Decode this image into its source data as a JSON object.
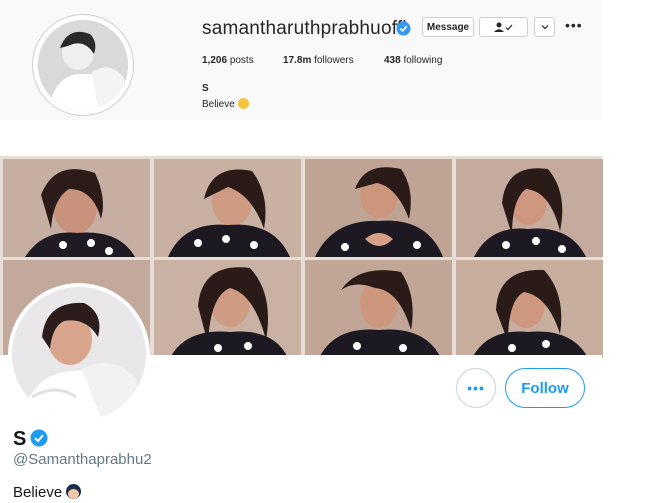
{
  "instagram": {
    "username": "samantharuthprabhuoffl",
    "buttons": {
      "message": "Message",
      "follow_icon": "person-check-icon",
      "more_icon": "chevron-down-icon"
    },
    "options_icon": "ellipsis-icon",
    "stats": {
      "posts": "1,206",
      "posts_label": "posts",
      "followers": "17.8m",
      "followers_label": "followers",
      "following": "438",
      "following_label": "following"
    },
    "display_name": "S",
    "bio": "Believe"
  },
  "photo_grid": {
    "tiles": 8
  },
  "twitter": {
    "display_name": "S",
    "handle": "@Samanthaprabhu2",
    "bio": "Believe",
    "more_label": "•••",
    "follow_label": "Follow"
  },
  "colors": {
    "twitter_blue": "#1d9bf0",
    "instagram_verified": "#3897f0"
  }
}
